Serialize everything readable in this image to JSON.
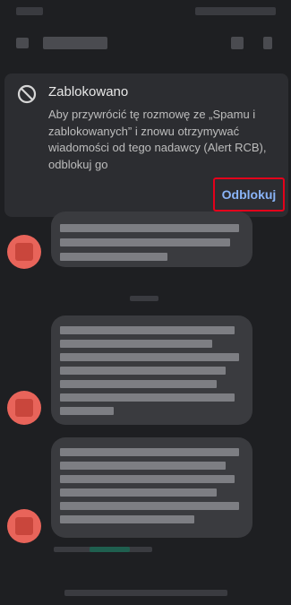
{
  "banner": {
    "icon": "block-icon",
    "title": "Zablokowano",
    "body": "Aby przywrócić tę rozmowę ze „Spamu i zablokowanych” i znowu otrzymywać wiadomości od tego nadawcy (Alert RCB), odblokuj go",
    "action_label": "Odblokuj"
  },
  "colors": {
    "background": "#1e1f22",
    "banner": "#2c2d31",
    "accent": "#8ab4f8",
    "highlight": "#e3001b",
    "avatar": "#e8645a"
  }
}
